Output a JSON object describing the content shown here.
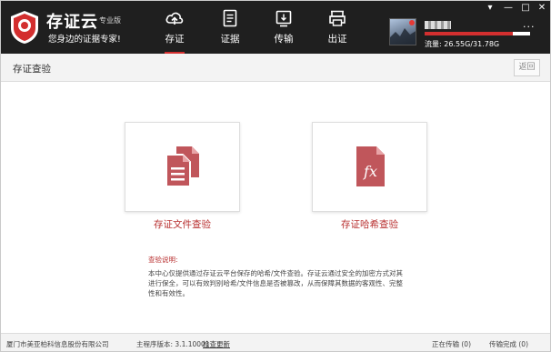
{
  "app": {
    "name": "存证云",
    "edition": "专业版",
    "slogan": "您身边的证据专家!"
  },
  "nav": [
    {
      "label": "存证",
      "icon": "cloud-upload-icon",
      "active": true
    },
    {
      "label": "证据",
      "icon": "document-list-icon",
      "active": false
    },
    {
      "label": "传输",
      "icon": "transfer-icon",
      "active": false
    },
    {
      "label": "出证",
      "icon": "print-icon",
      "active": false
    }
  ],
  "user": {
    "storage_text": "流量: 26.55G/31.78G",
    "storage_used_fraction": 0.835
  },
  "window_controls": {
    "menu": "▾",
    "minimize": "—",
    "maximize": "□",
    "close": "✕",
    "more": "···"
  },
  "page": {
    "title": "存证查验",
    "back_label": "返回"
  },
  "cards": [
    {
      "label": "存证文件查验",
      "icon": "documents-icon"
    },
    {
      "label": "存证哈希查验",
      "icon": "fx-file-icon"
    }
  ],
  "description": {
    "title": "查验说明:",
    "text": "本中心仅提供通过存证云平台保存的哈希/文件查验。存证云通过安全的加密方式对其进行保全，可以有效判别哈希/文件信息是否被篡改，从而保障其数据的客观性、完整性和有效性。"
  },
  "status": {
    "company": "厦门市美亚柏科信息股份有限公司",
    "version": "主程序版本: 3.1.10001",
    "update": "检查更新",
    "uploading": "正在传输 (0)",
    "completed": "传输完成 (0)"
  },
  "colors": {
    "topbar": "#1f1f1f",
    "accent": "#b82f2f",
    "icon_fill": "#c0565b"
  }
}
